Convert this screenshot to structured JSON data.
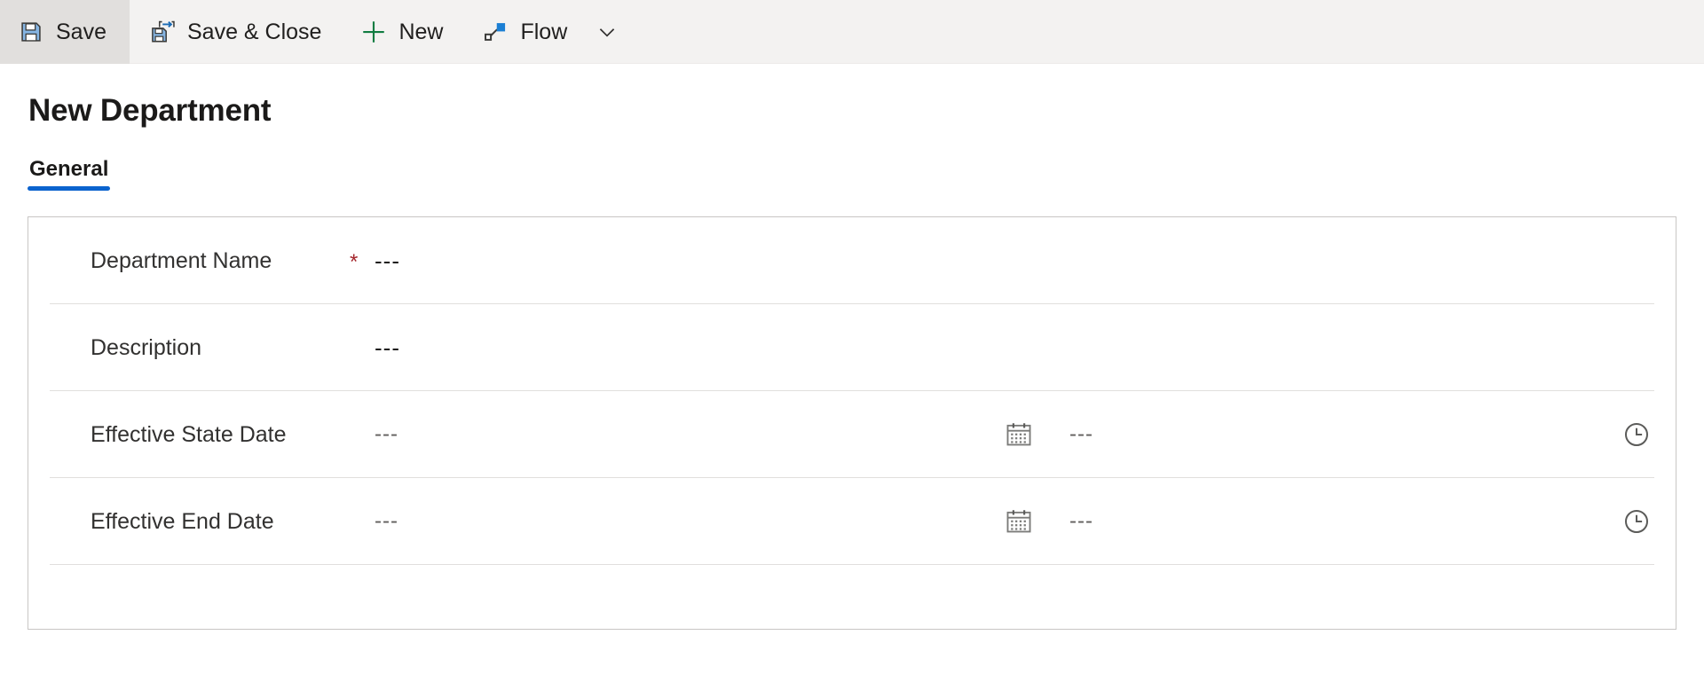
{
  "commandbar": {
    "buttons": [
      {
        "label": "Save",
        "icon": "save-icon",
        "active": true
      },
      {
        "label": "Save & Close",
        "icon": "save-and-close-icon",
        "active": false
      },
      {
        "label": "New",
        "icon": "plus-icon",
        "active": false
      },
      {
        "label": "Flow",
        "icon": "flow-icon",
        "active": false
      }
    ],
    "overflow_icon": "chevron-down-icon"
  },
  "page": {
    "title": "New Department"
  },
  "tabs": [
    {
      "label": "General",
      "selected": true
    }
  ],
  "form": {
    "rows": [
      {
        "label": "Department Name",
        "required": true,
        "required_marker": "*",
        "value": "---",
        "type": "text"
      },
      {
        "label": "Description",
        "required": false,
        "required_marker": "",
        "value": "---",
        "type": "text"
      },
      {
        "label": "Effective State Date",
        "required": false,
        "required_marker": "",
        "value": "---",
        "time_value": "---",
        "type": "datetime",
        "date_icon": "calendar-icon",
        "time_icon": "clock-icon"
      },
      {
        "label": "Effective End Date",
        "required": false,
        "required_marker": "",
        "value": "---",
        "time_value": "---",
        "type": "datetime",
        "date_icon": "calendar-icon",
        "time_icon": "clock-icon"
      }
    ]
  },
  "colors": {
    "accent": "#0b63ce",
    "required": "#a4262c",
    "commandbar_bg": "#f3f2f1",
    "active_btn_bg": "#e1dfdd",
    "new_icon_green": "#107c41",
    "flow_icon_blue": "#1a7fd4"
  }
}
